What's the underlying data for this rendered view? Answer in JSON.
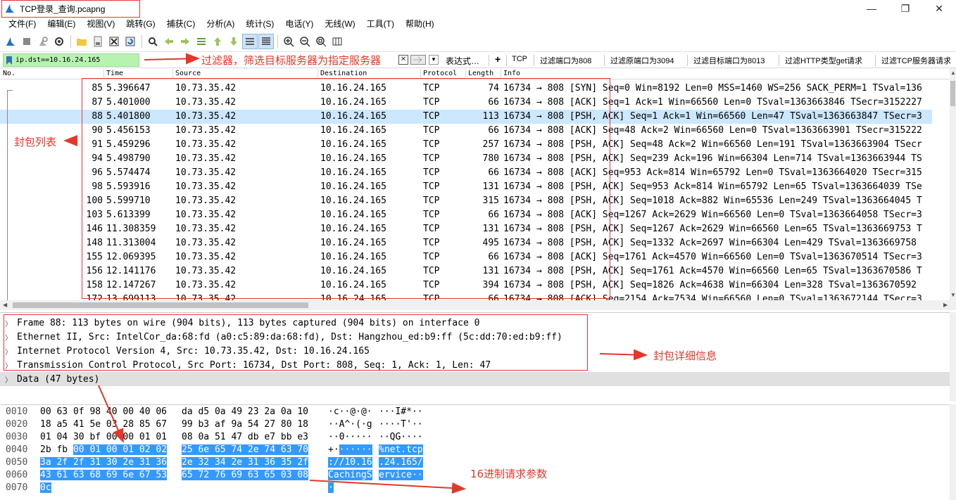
{
  "window": {
    "title": "TCP登录_查询.pcapng",
    "min": "—",
    "max": "❐",
    "close": "✕"
  },
  "menu": [
    "文件(F)",
    "编辑(E)",
    "视图(V)",
    "跳转(G)",
    "捕获(C)",
    "分析(A)",
    "统计(S)",
    "电话(Y)",
    "无线(W)",
    "工具(T)",
    "帮助(H)"
  ],
  "filter": {
    "value": "ip.dst==10.16.24.165",
    "clear": "✕",
    "expression_label": "表达式…",
    "plus": "+",
    "buttons": [
      "TCP",
      "过滤端口为808",
      "过滤原端口为3094",
      "过滤目标端口为8013",
      "过滤HTTP类型get请求",
      "过滤TCP服务器请求"
    ]
  },
  "packet_list": {
    "columns": {
      "no": "No.",
      "time": "Time",
      "source": "Source",
      "destination": "Destination",
      "protocol": "Protocol",
      "length": "Length",
      "info": "Info"
    },
    "rows": [
      {
        "no": "85",
        "time": "5.396647",
        "src": "10.73.35.42",
        "dst": "10.16.24.165",
        "proto": "TCP",
        "len": "74",
        "info": "16734 → 808 [SYN] Seq=0 Win=8192 Len=0 MSS=1460 WS=256 SACK_PERM=1 TSval=136"
      },
      {
        "no": "87",
        "time": "5.401000",
        "src": "10.73.35.42",
        "dst": "10.16.24.165",
        "proto": "TCP",
        "len": "66",
        "info": "16734 → 808 [ACK] Seq=1 Ack=1 Win=66560 Len=0 TSval=1363663846 TSecr=3152227"
      },
      {
        "no": "88",
        "time": "5.401800",
        "src": "10.73.35.42",
        "dst": "10.16.24.165",
        "proto": "TCP",
        "len": "113",
        "info": "16734 → 808 [PSH, ACK] Seq=1 Ack=1 Win=66560 Len=47 TSval=1363663847 TSecr=3"
      },
      {
        "no": "90",
        "time": "5.456153",
        "src": "10.73.35.42",
        "dst": "10.16.24.165",
        "proto": "TCP",
        "len": "66",
        "info": "16734 → 808 [ACK] Seq=48 Ack=2 Win=66560 Len=0 TSval=1363663901 TSecr=315222"
      },
      {
        "no": "91",
        "time": "5.459296",
        "src": "10.73.35.42",
        "dst": "10.16.24.165",
        "proto": "TCP",
        "len": "257",
        "info": "16734 → 808 [PSH, ACK] Seq=48 Ack=2 Win=66560 Len=191 TSval=1363663904 TSecr"
      },
      {
        "no": "94",
        "time": "5.498790",
        "src": "10.73.35.42",
        "dst": "10.16.24.165",
        "proto": "TCP",
        "len": "780",
        "info": "16734 → 808 [PSH, ACK] Seq=239 Ack=196 Win=66304 Len=714 TSval=1363663944 TS"
      },
      {
        "no": "96",
        "time": "5.574474",
        "src": "10.73.35.42",
        "dst": "10.16.24.165",
        "proto": "TCP",
        "len": "66",
        "info": "16734 → 808 [ACK] Seq=953 Ack=814 Win=65792 Len=0 TSval=1363664020 TSecr=315"
      },
      {
        "no": "98",
        "time": "5.593916",
        "src": "10.73.35.42",
        "dst": "10.16.24.165",
        "proto": "TCP",
        "len": "131",
        "info": "16734 → 808 [PSH, ACK] Seq=953 Ack=814 Win=65792 Len=65 TSval=1363664039 TSe"
      },
      {
        "no": "100",
        "time": "5.599710",
        "src": "10.73.35.42",
        "dst": "10.16.24.165",
        "proto": "TCP",
        "len": "315",
        "info": "16734 → 808 [PSH, ACK] Seq=1018 Ack=882 Win=65536 Len=249 TSval=1363664045 T"
      },
      {
        "no": "103",
        "time": "5.613399",
        "src": "10.73.35.42",
        "dst": "10.16.24.165",
        "proto": "TCP",
        "len": "66",
        "info": "16734 → 808 [ACK] Seq=1267 Ack=2629 Win=66560 Len=0 TSval=1363664058 TSecr=3"
      },
      {
        "no": "146",
        "time": "11.308359",
        "src": "10.73.35.42",
        "dst": "10.16.24.165",
        "proto": "TCP",
        "len": "131",
        "info": "16734 → 808 [PSH, ACK] Seq=1267 Ack=2629 Win=66560 Len=65 TSval=1363669753 T"
      },
      {
        "no": "148",
        "time": "11.313004",
        "src": "10.73.35.42",
        "dst": "10.16.24.165",
        "proto": "TCP",
        "len": "495",
        "info": "16734 → 808 [PSH, ACK] Seq=1332 Ack=2697 Win=66304 Len=429 TSval=1363669758"
      },
      {
        "no": "155",
        "time": "12.069395",
        "src": "10.73.35.42",
        "dst": "10.16.24.165",
        "proto": "TCP",
        "len": "66",
        "info": "16734 → 808 [ACK] Seq=1761 Ack=4570 Win=66560 Len=0 TSval=1363670514 TSecr=3"
      },
      {
        "no": "156",
        "time": "12.141176",
        "src": "10.73.35.42",
        "dst": "10.16.24.165",
        "proto": "TCP",
        "len": "131",
        "info": "16734 → 808 [PSH, ACK] Seq=1761 Ack=4570 Win=66560 Len=65 TSval=1363670586 T"
      },
      {
        "no": "158",
        "time": "12.147267",
        "src": "10.73.35.42",
        "dst": "10.16.24.165",
        "proto": "TCP",
        "len": "394",
        "info": "16734 → 808 [PSH, ACK] Seq=1826 Ack=4638 Win=66304 Len=328 TSval=1363670592"
      },
      {
        "no": "172",
        "time": "13.699113",
        "src": "10.73.35.42",
        "dst": "10.16.24.165",
        "proto": "TCP",
        "len": "66",
        "info": "16734 → 808 [ACK] Seq=2154 Ack=7534 Win=66560 Len=0 TSval=1363672144 TSecr=3"
      }
    ]
  },
  "details": [
    "Frame 88: 113 bytes on wire (904 bits), 113 bytes captured (904 bits) on interface 0",
    "Ethernet II, Src: IntelCor_da:68:fd (a0:c5:89:da:68:fd), Dst: Hangzhou_ed:b9:ff (5c:dd:70:ed:b9:ff)",
    "Internet Protocol Version 4, Src: 10.73.35.42, Dst: 10.16.24.165",
    "Transmission Control Protocol, Src Port: 16734, Dst Port: 808, Seq: 1, Ack: 1, Len: 47",
    "Data (47 bytes)"
  ],
  "bytes": [
    {
      "off": "0010",
      "b1": "00 63 0f 98 40 00 40 06",
      "b2": "da d5 0a 49 23 2a 0a 10",
      "a1": "·c··@·@·",
      "a2": "···I#*··"
    },
    {
      "off": "0020",
      "b1": "18 a5 41 5e 03 28 85 67",
      "b2": "99 b3 af 9a 54 27 80 18",
      "a1": "··A^·(·g",
      "a2": "····T'··"
    },
    {
      "off": "0030",
      "b1": "01 04 30 bf 00 00 01 01",
      "b2": "08 0a 51 47 db e7 bb e3",
      "a1": "··0·····",
      "a2": "··QG····"
    },
    {
      "off": "0040",
      "b1pre": "2b fb ",
      "b1": "00 01 00 01 02 02",
      "b2": "25 6e 65 74 2e 74 63 70",
      "a1pre": "+·",
      "a1": "······",
      "a2": "%net.tcp"
    },
    {
      "off": "0050",
      "b1": "3a 2f 2f 31 30 2e 31 36",
      "b2": "2e 32 34 2e 31 36 35 2f",
      "a1": "://10.16",
      "a2": ".24.165/"
    },
    {
      "off": "0060",
      "b1": "43 61 63 68 69 6e 67 53",
      "b2": "65 72 76 69 63 65 03 08",
      "a1": "CachingS",
      "a2": "ervice··"
    },
    {
      "off": "0070",
      "b1": "0c",
      "b2": "",
      "a1": "·",
      "a2": ""
    }
  ],
  "annotations": {
    "filter": "过滤器，筛选目标服务器为指定服务器",
    "packet_list": "封包列表",
    "details": "封包详细信息",
    "hex": "16进制请求参数"
  },
  "colors": {
    "filter_valid_bg": "#b7f3b0",
    "selection": "#cce8ff",
    "byte_highlight": "#3399ff",
    "annotation": "#e3382a"
  }
}
